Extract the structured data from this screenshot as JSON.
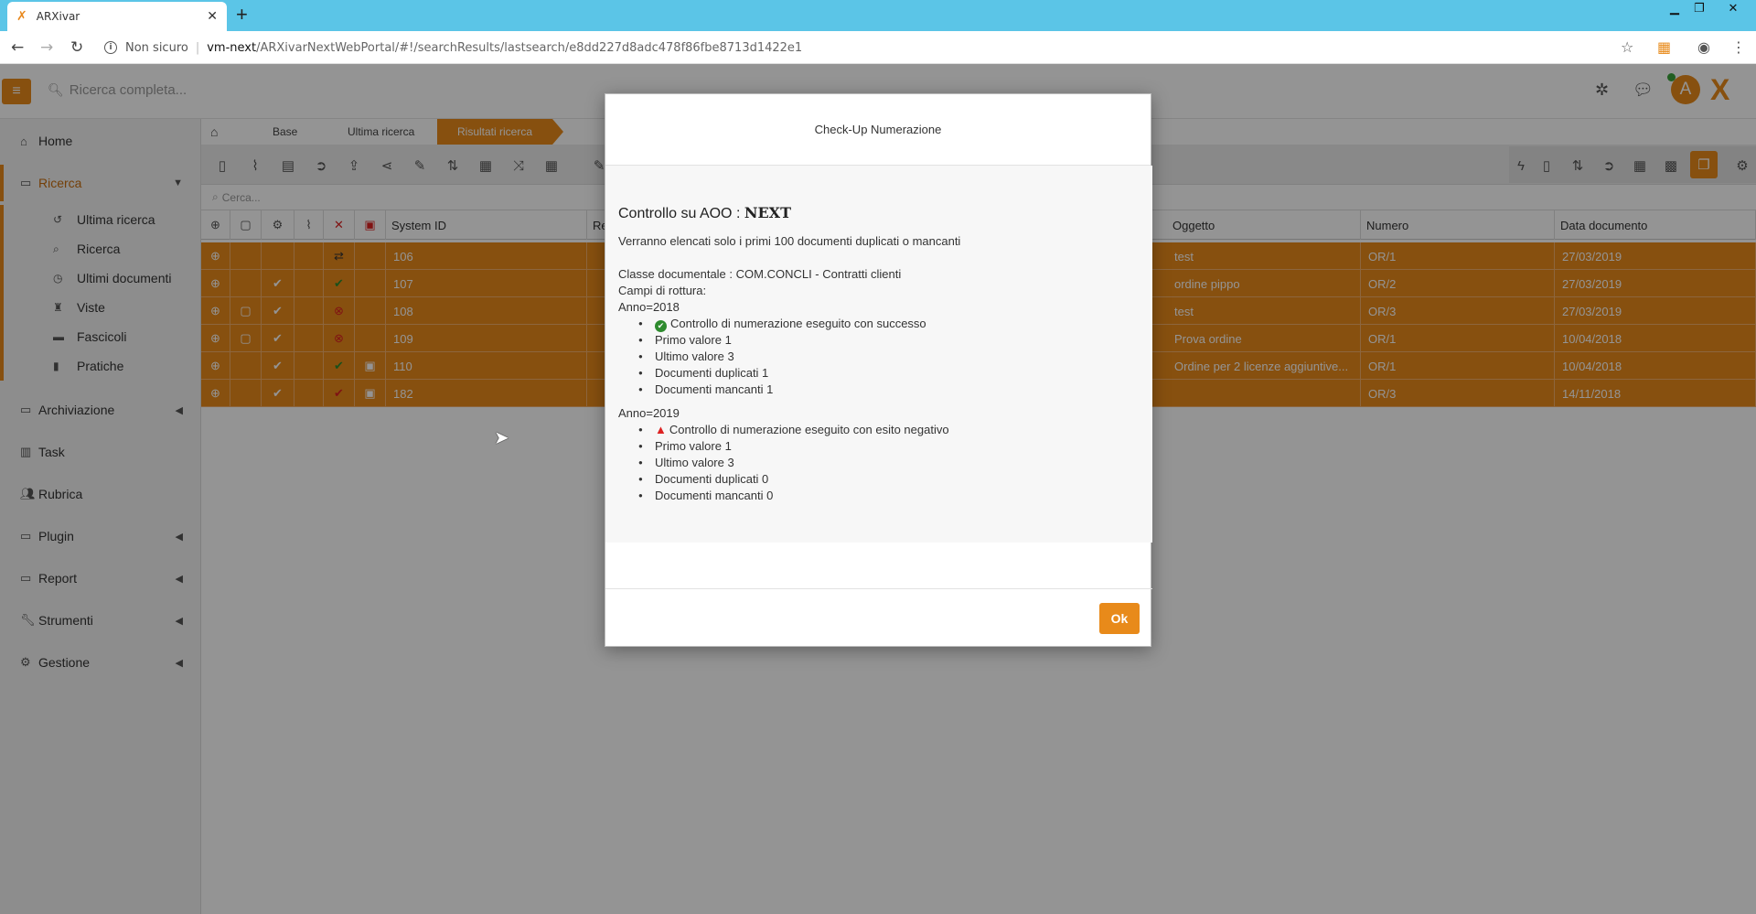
{
  "browser": {
    "tab_title": "ARXivar",
    "tab_close": "✕",
    "new_tab": "+",
    "not_secure": "Non sicuro",
    "url_host": "vm-next",
    "url_path": "/ARXivarNextWebPortal/#!/searchResults/lastsearch/e8dd227d8adc478f86fbe8713d1422e1"
  },
  "app": {
    "search_placeholder": "Ricerca completa...",
    "avatar_initial": "A",
    "brand_mark": "X"
  },
  "sidebar": {
    "items": [
      {
        "label": "Home",
        "icon": "home-icon"
      },
      {
        "label": "Ricerca",
        "icon": "folder-icon"
      },
      {
        "label": "Archiviazione",
        "icon": "folder-icon"
      },
      {
        "label": "Task",
        "icon": "columns-icon"
      },
      {
        "label": "Rubrica",
        "icon": "users-icon"
      },
      {
        "label": "Plugin",
        "icon": "folder-icon"
      },
      {
        "label": "Report",
        "icon": "folder-icon"
      },
      {
        "label": "Strumenti",
        "icon": "wrench-icon"
      },
      {
        "label": "Gestione",
        "icon": "cogs-icon"
      }
    ],
    "sub_items": [
      {
        "label": "Ultima ricerca",
        "icon": "history-icon"
      },
      {
        "label": "Ricerca",
        "icon": "search-icon"
      },
      {
        "label": "Ultimi documenti",
        "icon": "clock-icon"
      },
      {
        "label": "Viste",
        "icon": "binoculars-icon"
      },
      {
        "label": "Fascicoli",
        "icon": "folder-icon"
      },
      {
        "label": "Pratiche",
        "icon": "file-icon"
      }
    ]
  },
  "breadcrumb": {
    "items": [
      "Base",
      "Ultima ricerca",
      "Risultati ricerca"
    ]
  },
  "filter": {
    "placeholder": "Cerca..."
  },
  "grid": {
    "columns": {
      "system_id": "System ID",
      "re": "Re",
      "oggetto": "Oggetto",
      "numero": "Numero",
      "data_documento": "Data documento"
    },
    "rows": [
      {
        "system_id": "106",
        "oggetto": "test",
        "numero": "OR/1",
        "data": "27/03/2019"
      },
      {
        "system_id": "107",
        "oggetto": "ordine pippo",
        "numero": "OR/2",
        "data": "27/03/2019"
      },
      {
        "system_id": "108",
        "oggetto": "test",
        "numero": "OR/3",
        "data": "27/03/2019"
      },
      {
        "system_id": "109",
        "oggetto": "Prova ordine",
        "numero": "OR/1",
        "data": "10/04/2018"
      },
      {
        "system_id": "110",
        "oggetto": "Ordine per 2 licenze aggiuntive...",
        "numero": "OR/1",
        "data": "10/04/2018"
      },
      {
        "system_id": "182",
        "oggetto": "",
        "numero": "OR/3",
        "data": "14/11/2018"
      }
    ]
  },
  "modal": {
    "title": "Check-Up Numerazione",
    "heading_prefix": "Controllo su AOO : ",
    "heading_aoo": "NEXT",
    "subtitle": "Verranno elencati solo i primi 100 documenti duplicati o mancanti",
    "classe": "Classe documentale : COM.CONCLI - Contratti clienti",
    "campi": "Campi di rottura:",
    "groups": [
      {
        "anno": "Anno=2018",
        "status": "Controllo di numerazione eseguito con successo",
        "items": [
          "Primo valore 1",
          "Ultimo valore 3",
          "Documenti duplicati 1",
          "Documenti mancanti 1"
        ]
      },
      {
        "anno": "Anno=2019",
        "status": "Controllo di numerazione eseguito con esito negativo",
        "items": [
          "Primo valore 1",
          "Ultimo valore 3",
          "Documenti duplicati 0",
          "Documenti mancanti 0"
        ]
      }
    ],
    "ok_label": "Ok"
  },
  "colors": {
    "accent": "#e88a1a",
    "chrome": "#5bc5e7",
    "success": "#2e8b2e",
    "danger": "#dd2222"
  }
}
